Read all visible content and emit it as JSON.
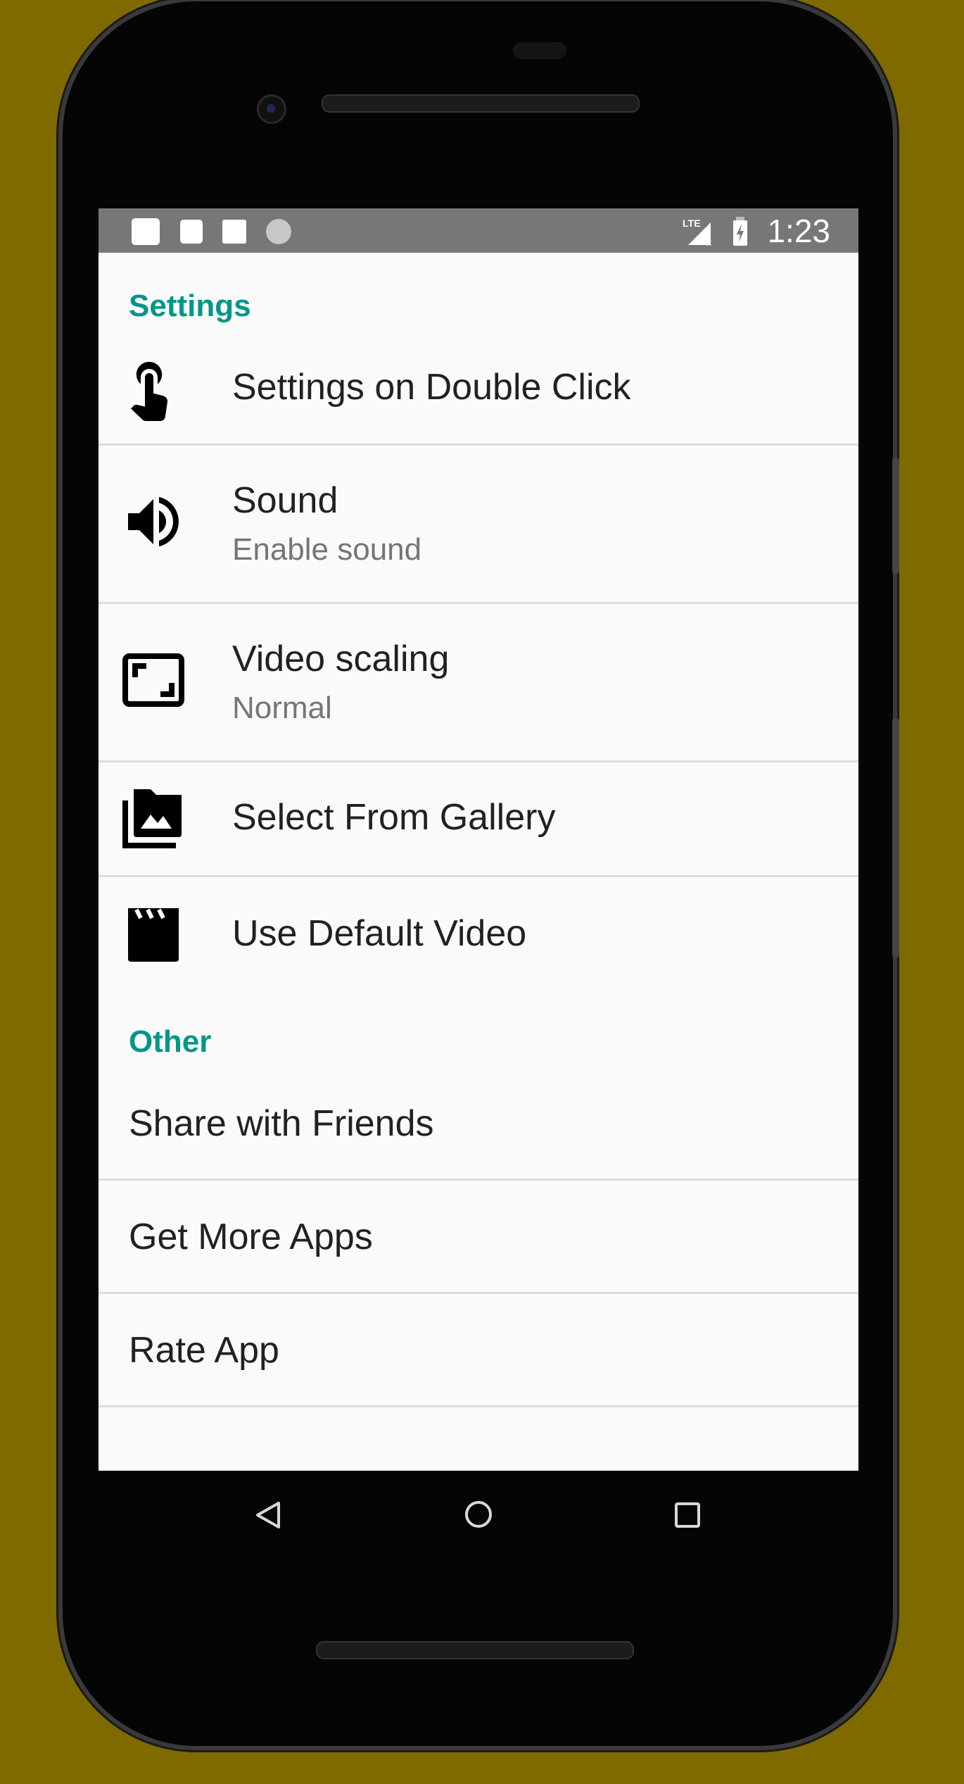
{
  "status_bar": {
    "time": "1:23",
    "network": "LTE",
    "icons": [
      "notification-icon",
      "notification-icon",
      "image-icon",
      "sync-icon",
      "signal-icon",
      "battery-charging-icon"
    ]
  },
  "colors": {
    "accent": "#009688",
    "background": "#7f6a00",
    "status_bar": "#777777"
  },
  "sections": [
    {
      "header": "Settings",
      "items": [
        {
          "title": "Settings on Double Click",
          "icon": "touch-icon",
          "checked": true
        },
        {
          "title": "Sound",
          "summary": "Enable sound",
          "icon": "volume-icon",
          "checked": false
        },
        {
          "title": "Video scaling",
          "summary": "Normal",
          "icon": "aspect-ratio-icon"
        },
        {
          "title": "Select From Gallery",
          "icon": "photo-library-icon"
        },
        {
          "title": "Use Default Video",
          "icon": "movie-icon"
        }
      ]
    },
    {
      "header": "Other",
      "items": [
        {
          "title": "Share with Friends"
        },
        {
          "title": "Get More Apps"
        },
        {
          "title": "Rate App"
        }
      ]
    }
  ],
  "navigation": [
    "back-icon",
    "home-icon",
    "recents-icon"
  ]
}
